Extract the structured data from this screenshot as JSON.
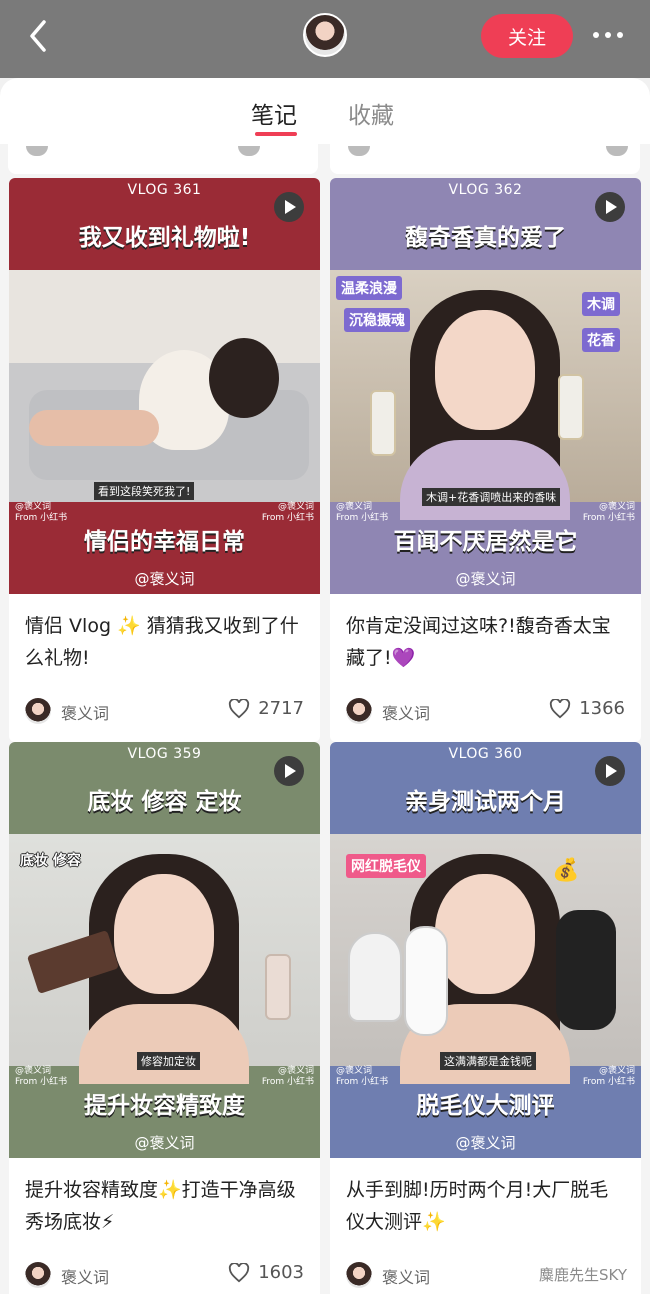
{
  "header": {
    "follow_label": "关注"
  },
  "tabs": [
    {
      "label": "笔记"
    },
    {
      "label": "收藏"
    }
  ],
  "cards": [
    {
      "vlog": "VLOG 361",
      "headline": "我又收到礼物啦!",
      "caption": "看到这段笑死我了!",
      "bottom_title": "情侣的幸福日常",
      "handle": "@褒义词",
      "watermark_name": "@褒义词",
      "watermark_from": "From 小红书",
      "description": "情侣 Vlog ✨ 猜猜我又收到了什么礼物!",
      "author": "褒义词",
      "likes": "2717",
      "colors": {
        "band": "#9a2b36"
      }
    },
    {
      "vlog": "VLOG 362",
      "headline": "馥奇香真的爱了",
      "tags": [
        "温柔浪漫",
        "沉稳摄魂",
        "木调",
        "花香"
      ],
      "caption": "木调+花香调喷出来的香味",
      "bottom_title": "百闻不厌居然是它",
      "handle": "@褒义词",
      "watermark_name": "@褒义词",
      "watermark_from": "From 小红书",
      "description": "你肯定没闻过这味?!馥奇香太宝藏了!💜",
      "author": "褒义词",
      "likes": "1366",
      "colors": {
        "band": "#8f86b3"
      }
    },
    {
      "vlog": "VLOG 359",
      "headline": "底妆 修容 定妆",
      "tags": [
        "底妆 修容"
      ],
      "caption": "修容加定妆",
      "bottom_title": "提升妆容精致度",
      "handle": "@褒义词",
      "watermark_name": "@褒义词",
      "watermark_from": "From 小红书",
      "description": "提升妆容精致度✨打造干净高级秀场底妆⚡",
      "author": "褒义词",
      "likes": "1603",
      "colors": {
        "band": "#7b8b6d"
      }
    },
    {
      "vlog": "VLOG 360",
      "headline": "亲身测试两个月",
      "tags": [
        "网红脱毛仪"
      ],
      "caption": "这满满都是金钱呢",
      "bottom_title": "脱毛仪大测评",
      "handle": "@褒义词",
      "watermark_name": "@褒义词",
      "watermark_from": "From 小红书",
      "description": "从手到脚!历时两个月!大厂脱毛仪大测评✨",
      "author": "褒义词",
      "colors": {
        "band": "#6f7eb0"
      }
    }
  ],
  "overlay_watermark": "麋鹿先生SKY"
}
